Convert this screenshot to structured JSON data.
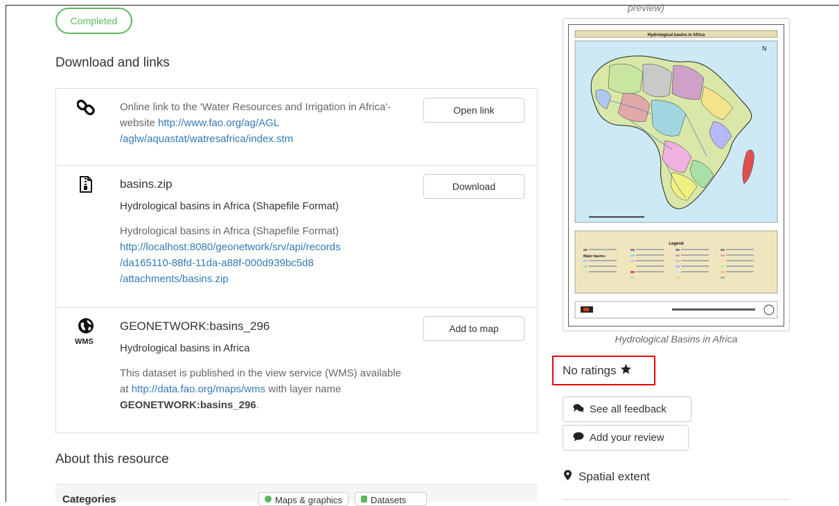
{
  "status_badge": "Completed",
  "download_section": {
    "title": "Download and links",
    "items": [
      {
        "icon": "link-icon",
        "description": "Online link to the 'Water Resources and Irrigation in Africa'- website ",
        "url_line1": "http://www.fao.org/ag/AGL",
        "url_line2": "/aglw/aquastat/watresafrica/index.stm",
        "button": "Open link"
      },
      {
        "icon": "zip-file-icon",
        "title": "basins.zip",
        "subtitle": "Hydrological basins in Africa (Shapefile Format)",
        "description": "Hydrological basins in Africa (Shapefile Format)",
        "url_line1": "http://localhost:8080/geonetwork/srv/api/records",
        "url_line2": "/da165110-88fd-11da-a88f-000d939bc5d8",
        "url_line3": "/attachments/basins.zip",
        "button": "Download"
      },
      {
        "icon": "globe-icon",
        "icon_label": "WMS",
        "title": "GEONETWORK:basins_296",
        "subtitle": "Hydrological basins in Africa",
        "desc_part1": "This dataset is published in the view service (WMS) available at ",
        "url": "http://data.fao.org/maps/wms",
        "desc_part2": " with layer name ",
        "layer_name": "GEONETWORK:basins_296",
        "desc_end": ".",
        "button": "Add to map"
      }
    ]
  },
  "about_section": {
    "title": "About this resource",
    "categories_label": "Categories",
    "chips": [
      "Maps & graphics",
      "Datasets"
    ]
  },
  "sidebar": {
    "preview_caption_top": "preview)",
    "thumbnail": {
      "map_title": "Hydrological basins in Africa",
      "legend_title": "Legend",
      "major_basins_label": "Major basins:"
    },
    "thumbnail_caption": "Hydrological Basins in Africa",
    "ratings": "No ratings",
    "feedback_button": "See all feedback",
    "review_button": "Add your review",
    "spatial_extent": "Spatial extent"
  },
  "colors": {
    "badge_green": "#5cb85c",
    "link_blue": "#337ab7",
    "highlight_red": "#ee0000"
  }
}
